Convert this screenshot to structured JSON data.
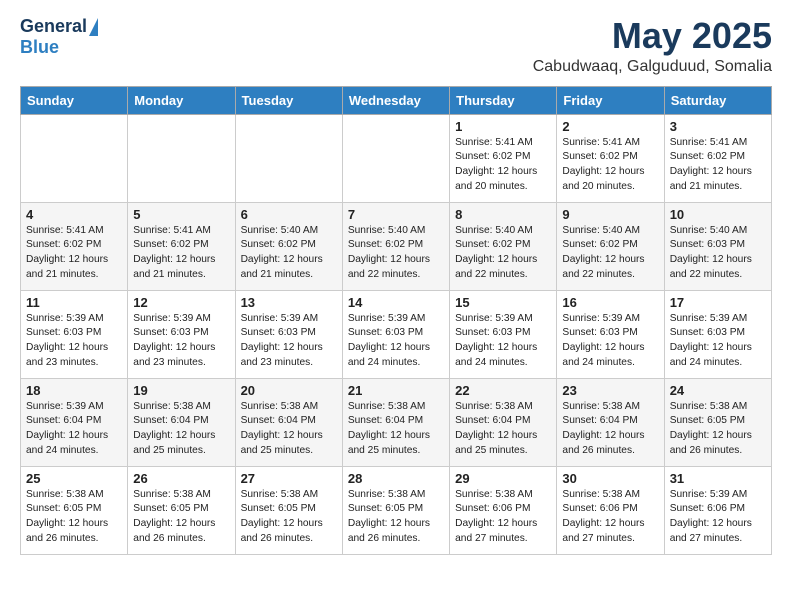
{
  "header": {
    "logo": {
      "general": "General",
      "blue": "Blue"
    },
    "title": "May 2025",
    "location": "Cabudwaaq, Galguduud, Somalia"
  },
  "days_of_week": [
    "Sunday",
    "Monday",
    "Tuesday",
    "Wednesday",
    "Thursday",
    "Friday",
    "Saturday"
  ],
  "weeks": [
    [
      {
        "day": "",
        "info": ""
      },
      {
        "day": "",
        "info": ""
      },
      {
        "day": "",
        "info": ""
      },
      {
        "day": "",
        "info": ""
      },
      {
        "day": "1",
        "info": "Sunrise: 5:41 AM\nSunset: 6:02 PM\nDaylight: 12 hours\nand 20 minutes."
      },
      {
        "day": "2",
        "info": "Sunrise: 5:41 AM\nSunset: 6:02 PM\nDaylight: 12 hours\nand 20 minutes."
      },
      {
        "day": "3",
        "info": "Sunrise: 5:41 AM\nSunset: 6:02 PM\nDaylight: 12 hours\nand 21 minutes."
      }
    ],
    [
      {
        "day": "4",
        "info": "Sunrise: 5:41 AM\nSunset: 6:02 PM\nDaylight: 12 hours\nand 21 minutes."
      },
      {
        "day": "5",
        "info": "Sunrise: 5:41 AM\nSunset: 6:02 PM\nDaylight: 12 hours\nand 21 minutes."
      },
      {
        "day": "6",
        "info": "Sunrise: 5:40 AM\nSunset: 6:02 PM\nDaylight: 12 hours\nand 21 minutes."
      },
      {
        "day": "7",
        "info": "Sunrise: 5:40 AM\nSunset: 6:02 PM\nDaylight: 12 hours\nand 22 minutes."
      },
      {
        "day": "8",
        "info": "Sunrise: 5:40 AM\nSunset: 6:02 PM\nDaylight: 12 hours\nand 22 minutes."
      },
      {
        "day": "9",
        "info": "Sunrise: 5:40 AM\nSunset: 6:02 PM\nDaylight: 12 hours\nand 22 minutes."
      },
      {
        "day": "10",
        "info": "Sunrise: 5:40 AM\nSunset: 6:03 PM\nDaylight: 12 hours\nand 22 minutes."
      }
    ],
    [
      {
        "day": "11",
        "info": "Sunrise: 5:39 AM\nSunset: 6:03 PM\nDaylight: 12 hours\nand 23 minutes."
      },
      {
        "day": "12",
        "info": "Sunrise: 5:39 AM\nSunset: 6:03 PM\nDaylight: 12 hours\nand 23 minutes."
      },
      {
        "day": "13",
        "info": "Sunrise: 5:39 AM\nSunset: 6:03 PM\nDaylight: 12 hours\nand 23 minutes."
      },
      {
        "day": "14",
        "info": "Sunrise: 5:39 AM\nSunset: 6:03 PM\nDaylight: 12 hours\nand 24 minutes."
      },
      {
        "day": "15",
        "info": "Sunrise: 5:39 AM\nSunset: 6:03 PM\nDaylight: 12 hours\nand 24 minutes."
      },
      {
        "day": "16",
        "info": "Sunrise: 5:39 AM\nSunset: 6:03 PM\nDaylight: 12 hours\nand 24 minutes."
      },
      {
        "day": "17",
        "info": "Sunrise: 5:39 AM\nSunset: 6:03 PM\nDaylight: 12 hours\nand 24 minutes."
      }
    ],
    [
      {
        "day": "18",
        "info": "Sunrise: 5:39 AM\nSunset: 6:04 PM\nDaylight: 12 hours\nand 24 minutes."
      },
      {
        "day": "19",
        "info": "Sunrise: 5:38 AM\nSunset: 6:04 PM\nDaylight: 12 hours\nand 25 minutes."
      },
      {
        "day": "20",
        "info": "Sunrise: 5:38 AM\nSunset: 6:04 PM\nDaylight: 12 hours\nand 25 minutes."
      },
      {
        "day": "21",
        "info": "Sunrise: 5:38 AM\nSunset: 6:04 PM\nDaylight: 12 hours\nand 25 minutes."
      },
      {
        "day": "22",
        "info": "Sunrise: 5:38 AM\nSunset: 6:04 PM\nDaylight: 12 hours\nand 25 minutes."
      },
      {
        "day": "23",
        "info": "Sunrise: 5:38 AM\nSunset: 6:04 PM\nDaylight: 12 hours\nand 26 minutes."
      },
      {
        "day": "24",
        "info": "Sunrise: 5:38 AM\nSunset: 6:05 PM\nDaylight: 12 hours\nand 26 minutes."
      }
    ],
    [
      {
        "day": "25",
        "info": "Sunrise: 5:38 AM\nSunset: 6:05 PM\nDaylight: 12 hours\nand 26 minutes."
      },
      {
        "day": "26",
        "info": "Sunrise: 5:38 AM\nSunset: 6:05 PM\nDaylight: 12 hours\nand 26 minutes."
      },
      {
        "day": "27",
        "info": "Sunrise: 5:38 AM\nSunset: 6:05 PM\nDaylight: 12 hours\nand 26 minutes."
      },
      {
        "day": "28",
        "info": "Sunrise: 5:38 AM\nSunset: 6:05 PM\nDaylight: 12 hours\nand 26 minutes."
      },
      {
        "day": "29",
        "info": "Sunrise: 5:38 AM\nSunset: 6:06 PM\nDaylight: 12 hours\nand 27 minutes."
      },
      {
        "day": "30",
        "info": "Sunrise: 5:38 AM\nSunset: 6:06 PM\nDaylight: 12 hours\nand 27 minutes."
      },
      {
        "day": "31",
        "info": "Sunrise: 5:39 AM\nSunset: 6:06 PM\nDaylight: 12 hours\nand 27 minutes."
      }
    ]
  ]
}
